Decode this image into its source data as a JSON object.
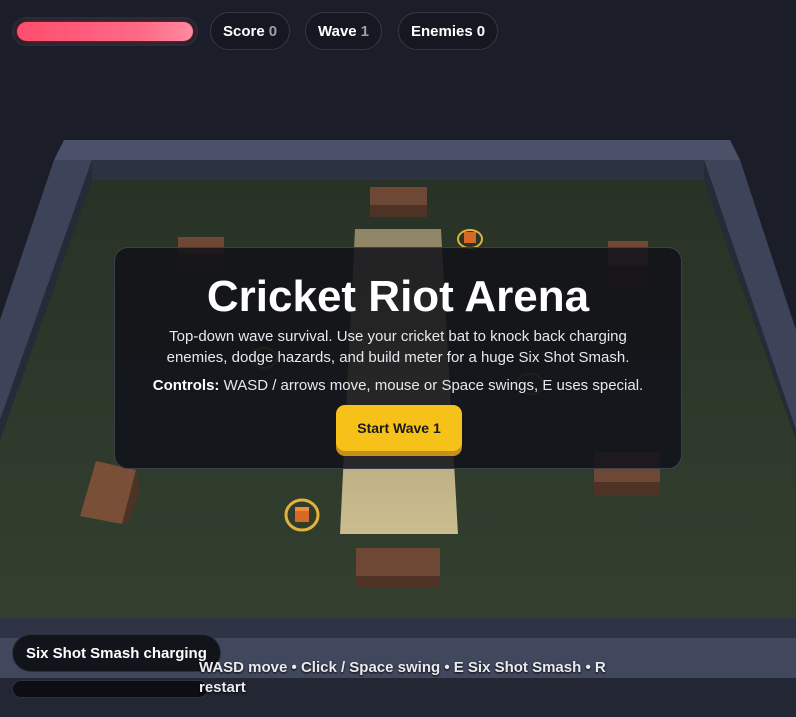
{
  "hud": {
    "health_fraction": 1.0,
    "score_label": "Score",
    "score_value": "0",
    "wave_label": "Wave",
    "wave_value": "1",
    "enemies_label": "Enemies",
    "enemies_value": "0"
  },
  "overlay": {
    "title": "Cricket Riot Arena",
    "description": "Top-down wave survival. Use your cricket bat to knock back charging enemies, dodge hazards, and build meter for a huge Six Shot Smash.",
    "controls_label": "Controls:",
    "controls_text": "WASD / arrows move, mouse or Space swings, E uses special.",
    "start_button": "Start Wave 1"
  },
  "special": {
    "label": "Six Shot Smash charging",
    "charge_fraction": 0.0
  },
  "help": {
    "text": "WASD move • Click / Space swing • E Six Shot Smash • R restart"
  },
  "colors": {
    "health": "#ff4d6d",
    "accent": "#f6c21a",
    "background": "#1b1e28",
    "ground": "#2f3a2c",
    "wall": "#3a4156",
    "crate": "#6b4632",
    "pitch": "#c9b98a"
  }
}
